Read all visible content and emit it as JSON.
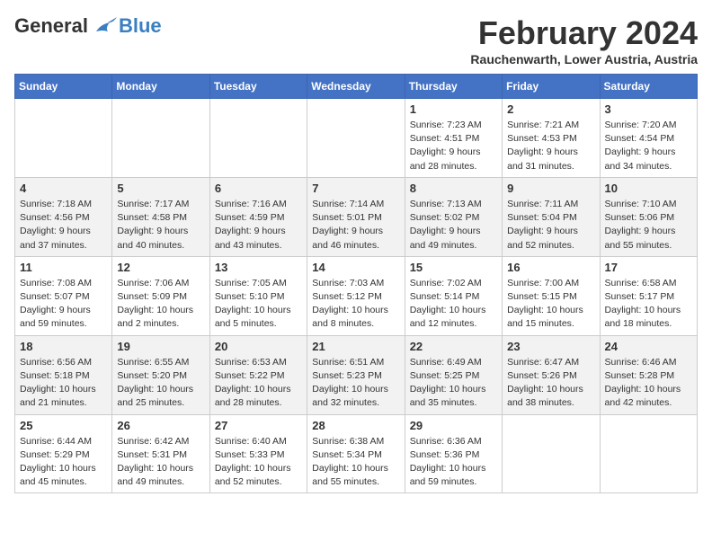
{
  "header": {
    "logo_general": "General",
    "logo_blue": "Blue",
    "month_title": "February 2024",
    "subtitle": "Rauchenwarth, Lower Austria, Austria"
  },
  "days_of_week": [
    "Sunday",
    "Monday",
    "Tuesday",
    "Wednesday",
    "Thursday",
    "Friday",
    "Saturday"
  ],
  "weeks": [
    [
      {
        "day": "",
        "info": ""
      },
      {
        "day": "",
        "info": ""
      },
      {
        "day": "",
        "info": ""
      },
      {
        "day": "",
        "info": ""
      },
      {
        "day": "1",
        "info": "Sunrise: 7:23 AM\nSunset: 4:51 PM\nDaylight: 9 hours and 28 minutes."
      },
      {
        "day": "2",
        "info": "Sunrise: 7:21 AM\nSunset: 4:53 PM\nDaylight: 9 hours and 31 minutes."
      },
      {
        "day": "3",
        "info": "Sunrise: 7:20 AM\nSunset: 4:54 PM\nDaylight: 9 hours and 34 minutes."
      }
    ],
    [
      {
        "day": "4",
        "info": "Sunrise: 7:18 AM\nSunset: 4:56 PM\nDaylight: 9 hours and 37 minutes."
      },
      {
        "day": "5",
        "info": "Sunrise: 7:17 AM\nSunset: 4:58 PM\nDaylight: 9 hours and 40 minutes."
      },
      {
        "day": "6",
        "info": "Sunrise: 7:16 AM\nSunset: 4:59 PM\nDaylight: 9 hours and 43 minutes."
      },
      {
        "day": "7",
        "info": "Sunrise: 7:14 AM\nSunset: 5:01 PM\nDaylight: 9 hours and 46 minutes."
      },
      {
        "day": "8",
        "info": "Sunrise: 7:13 AM\nSunset: 5:02 PM\nDaylight: 9 hours and 49 minutes."
      },
      {
        "day": "9",
        "info": "Sunrise: 7:11 AM\nSunset: 5:04 PM\nDaylight: 9 hours and 52 minutes."
      },
      {
        "day": "10",
        "info": "Sunrise: 7:10 AM\nSunset: 5:06 PM\nDaylight: 9 hours and 55 minutes."
      }
    ],
    [
      {
        "day": "11",
        "info": "Sunrise: 7:08 AM\nSunset: 5:07 PM\nDaylight: 9 hours and 59 minutes."
      },
      {
        "day": "12",
        "info": "Sunrise: 7:06 AM\nSunset: 5:09 PM\nDaylight: 10 hours and 2 minutes."
      },
      {
        "day": "13",
        "info": "Sunrise: 7:05 AM\nSunset: 5:10 PM\nDaylight: 10 hours and 5 minutes."
      },
      {
        "day": "14",
        "info": "Sunrise: 7:03 AM\nSunset: 5:12 PM\nDaylight: 10 hours and 8 minutes."
      },
      {
        "day": "15",
        "info": "Sunrise: 7:02 AM\nSunset: 5:14 PM\nDaylight: 10 hours and 12 minutes."
      },
      {
        "day": "16",
        "info": "Sunrise: 7:00 AM\nSunset: 5:15 PM\nDaylight: 10 hours and 15 minutes."
      },
      {
        "day": "17",
        "info": "Sunrise: 6:58 AM\nSunset: 5:17 PM\nDaylight: 10 hours and 18 minutes."
      }
    ],
    [
      {
        "day": "18",
        "info": "Sunrise: 6:56 AM\nSunset: 5:18 PM\nDaylight: 10 hours and 21 minutes."
      },
      {
        "day": "19",
        "info": "Sunrise: 6:55 AM\nSunset: 5:20 PM\nDaylight: 10 hours and 25 minutes."
      },
      {
        "day": "20",
        "info": "Sunrise: 6:53 AM\nSunset: 5:22 PM\nDaylight: 10 hours and 28 minutes."
      },
      {
        "day": "21",
        "info": "Sunrise: 6:51 AM\nSunset: 5:23 PM\nDaylight: 10 hours and 32 minutes."
      },
      {
        "day": "22",
        "info": "Sunrise: 6:49 AM\nSunset: 5:25 PM\nDaylight: 10 hours and 35 minutes."
      },
      {
        "day": "23",
        "info": "Sunrise: 6:47 AM\nSunset: 5:26 PM\nDaylight: 10 hours and 38 minutes."
      },
      {
        "day": "24",
        "info": "Sunrise: 6:46 AM\nSunset: 5:28 PM\nDaylight: 10 hours and 42 minutes."
      }
    ],
    [
      {
        "day": "25",
        "info": "Sunrise: 6:44 AM\nSunset: 5:29 PM\nDaylight: 10 hours and 45 minutes."
      },
      {
        "day": "26",
        "info": "Sunrise: 6:42 AM\nSunset: 5:31 PM\nDaylight: 10 hours and 49 minutes."
      },
      {
        "day": "27",
        "info": "Sunrise: 6:40 AM\nSunset: 5:33 PM\nDaylight: 10 hours and 52 minutes."
      },
      {
        "day": "28",
        "info": "Sunrise: 6:38 AM\nSunset: 5:34 PM\nDaylight: 10 hours and 55 minutes."
      },
      {
        "day": "29",
        "info": "Sunrise: 6:36 AM\nSunset: 5:36 PM\nDaylight: 10 hours and 59 minutes."
      },
      {
        "day": "",
        "info": ""
      },
      {
        "day": "",
        "info": ""
      }
    ]
  ]
}
